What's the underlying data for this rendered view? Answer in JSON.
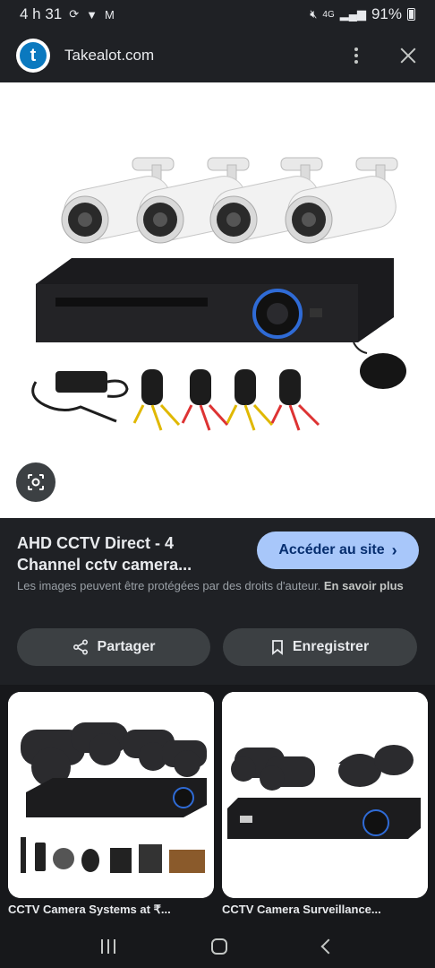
{
  "status_bar": {
    "time": "4 h 31",
    "network": "4G",
    "battery": "91%"
  },
  "header": {
    "logo_letter": "t",
    "site_name": "Takealot.com"
  },
  "result": {
    "title": "AHD CCTV Direct - 4 Channel cctv camera...",
    "visit_label": "Accéder au site",
    "copyright_text": "Les images peuvent être protégées par des droits d'auteur.",
    "learn_more": "En savoir plus",
    "share_label": "Partager",
    "save_label": "Enregistrer"
  },
  "related": [
    {
      "label": "CCTV Camera Systems at ₹..."
    },
    {
      "label": "CCTV Camera Surveillance..."
    }
  ],
  "colors": {
    "background": "#1f2125",
    "accent_button": "#a8c7fa",
    "takealot_blue": "#0b79bf"
  }
}
